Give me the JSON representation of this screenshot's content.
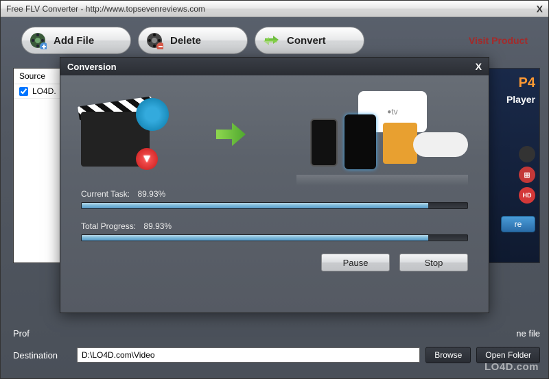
{
  "window": {
    "title": "Free FLV Converter - http://www.topsevenreviews.com",
    "close": "X"
  },
  "toolbar": {
    "addFile": "Add File",
    "delete": "Delete",
    "convert": "Convert",
    "visitProduct": "Visit Product"
  },
  "source": {
    "header": "Source",
    "items": [
      {
        "checked": true,
        "label": "LO4D."
      }
    ]
  },
  "side": {
    "p4": "P4",
    "player": "Player",
    "hd": "HD",
    "button": "re"
  },
  "profile": {
    "label": "Prof",
    "right": "ne file"
  },
  "destination": {
    "label": "Destination",
    "value": "D:\\LO4D.com\\Video",
    "browse": "Browse",
    "openFolder": "Open Folder"
  },
  "dialog": {
    "title": "Conversion",
    "close": "X",
    "tvLabel": "tv",
    "currentTask": {
      "label": "Current Task:",
      "percentText": "89.93%",
      "percent": 89.93
    },
    "totalProgress": {
      "label": "Total Progress:",
      "percentText": "89.93%",
      "percent": 89.93
    },
    "pause": "Pause",
    "stop": "Stop"
  },
  "watermark": "LO4D.com"
}
